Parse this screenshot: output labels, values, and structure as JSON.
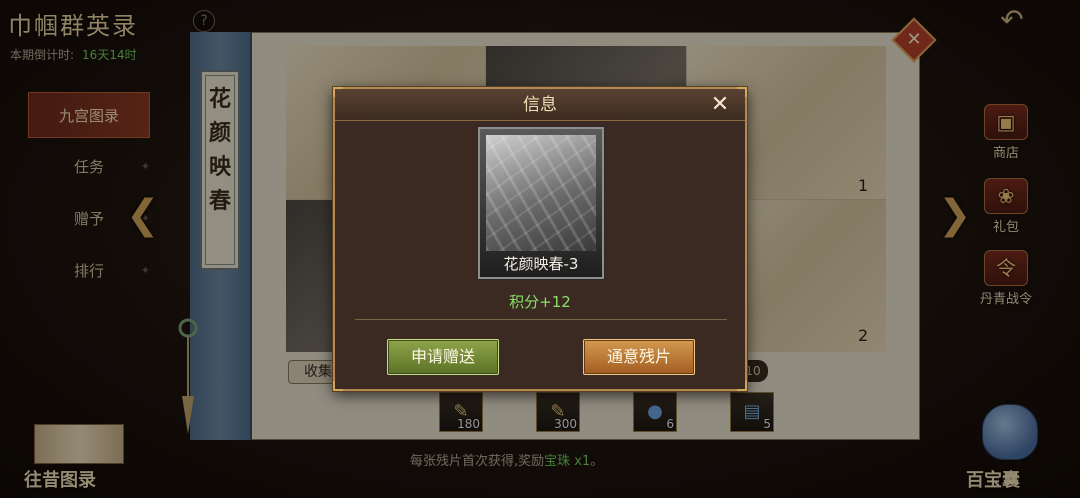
{
  "header": {
    "title": "巾帼群英录",
    "help_label": "?",
    "countdown_label": "本期倒计时:",
    "countdown_value": "16天14时",
    "back_icon": "back-arrow-icon"
  },
  "left_nav": {
    "items": [
      {
        "label": "九宫图录",
        "active": true
      },
      {
        "label": "任务",
        "active": false
      },
      {
        "label": "赠予",
        "active": false
      },
      {
        "label": "排行",
        "active": false
      }
    ]
  },
  "scroll": {
    "title": "花颜映春",
    "marks": [
      "1",
      "2"
    ],
    "collect_label": "收集",
    "right_pill": "10"
  },
  "right_side": {
    "items": [
      {
        "label": "商店",
        "icon": "chest-icon"
      },
      {
        "label": "礼包",
        "icon": "gift-bag-icon"
      },
      {
        "label": "丹青战令",
        "icon": "battle-pass-icon"
      }
    ]
  },
  "rewards": [
    {
      "icon": "scroll-item-icon",
      "count": "180"
    },
    {
      "icon": "scroll-item-icon",
      "count": "300"
    },
    {
      "icon": "orb-item-icon",
      "count": "6"
    },
    {
      "icon": "book-item-icon",
      "count": "5"
    }
  ],
  "bottom": {
    "hint_prefix": "每张残片首次获得,奖励",
    "hint_highlight": "宝珠 x1",
    "hint_suffix": "。",
    "past_label": "往昔图录",
    "treasure_label": "百宝囊"
  },
  "modal": {
    "title": "信息",
    "close_label": "✕",
    "card_name": "花颜映春-3",
    "points": "积分+12",
    "request_button": "申请赠送",
    "exchange_button": "通意残片"
  },
  "colors": {
    "accent_green": "#8be06a",
    "button_green": "#8ea44a",
    "button_orange": "#d39a4f",
    "frame_gold": "#b08a52"
  }
}
